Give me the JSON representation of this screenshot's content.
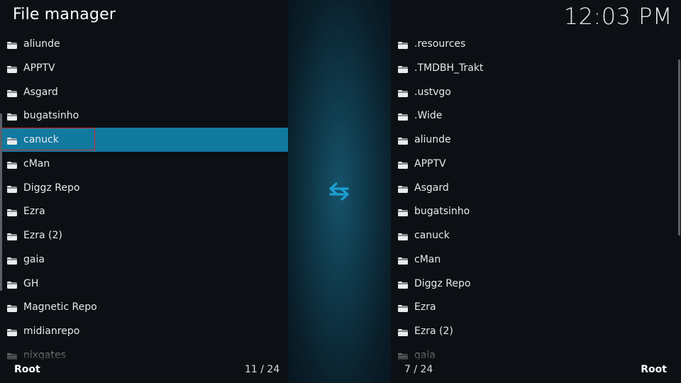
{
  "header": {
    "title": "File manager",
    "clock": "12:03 PM"
  },
  "left": {
    "items": [
      "aliunde",
      "APPTV",
      "Asgard",
      "bugatsinho",
      "canuck",
      "cMan",
      "Diggz Repo",
      "Ezra",
      "Ezra (2)",
      "gaia",
      "GH",
      "Magnetic Repo",
      "midianrepo",
      "nixgates"
    ],
    "selected_index": 4,
    "footer_label": "Root",
    "footer_count": "11 / 24"
  },
  "right": {
    "items": [
      ".resources",
      ".TMDBH_Trakt",
      ".ustvgo",
      ".Wide",
      "aliunde",
      "APPTV",
      "Asgard",
      "bugatsinho",
      "canuck",
      "cMan",
      "Diggz Repo",
      "Ezra",
      "Ezra (2)",
      "gaia"
    ],
    "footer_label": "Root",
    "footer_count": "7 / 24"
  },
  "icons": {
    "folder": "folder-icon",
    "swap": "swap-arrows-icon"
  },
  "colors": {
    "selected_row": "#12799f",
    "focus_outline": "#d02a2a",
    "swap_icon": "#1b9fd1"
  }
}
